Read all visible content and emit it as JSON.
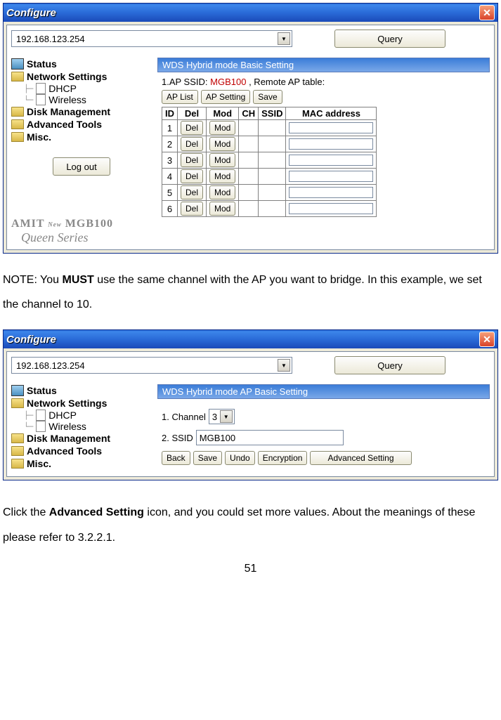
{
  "window_title": "Configure",
  "address": "192.168.123.254",
  "query_btn": "Query",
  "sidebar": {
    "status": "Status",
    "network": "Network Settings",
    "dhcp": "DHCP",
    "wireless": "Wireless",
    "disk": "Disk Management",
    "advanced": "Advanced Tools",
    "misc": "Misc.",
    "logout": "Log out",
    "brand_prefix": "AMIT",
    "brand_new": "New",
    "brand_model": "MGB100",
    "brand_series": "Queen Series"
  },
  "screen1": {
    "panel_title": "WDS Hybrid mode Basic Setting",
    "line_ssid_label": "1.AP SSID:",
    "line_ssid_value": "MGB100",
    "line_remote": ", Remote AP table:",
    "btn_aplist": "AP List",
    "btn_apsetting": "AP Setting",
    "btn_save": "Save",
    "hdr_id": "ID",
    "hdr_del": "Del",
    "hdr_mod": "Mod",
    "hdr_ch": "CH",
    "hdr_ssid": "SSID",
    "hdr_mac": "MAC address",
    "rowcell_del": "Del",
    "rowcell_mod": "Mod",
    "row_ids": [
      "1",
      "2",
      "3",
      "4",
      "5",
      "6"
    ]
  },
  "note_text_pre": "NOTE: You ",
  "note_must": "MUST",
  "note_text_post": " use the same channel with the AP you want to bridge. In this example, we set the channel to 10.",
  "screen2": {
    "panel_title": "WDS Hybrid mode AP Basic Setting",
    "lbl_channel": "1. Channel",
    "channel_value": "3",
    "lbl_ssid": "2. SSID",
    "ssid_value": "MGB100",
    "btn_back": "Back",
    "btn_save": "Save",
    "btn_undo": "Undo",
    "btn_encryption": "Encryption",
    "btn_advanced": "Advanced Setting"
  },
  "bottom_text_pre": "Click the ",
  "bottom_bold": "Advanced Setting",
  "bottom_text_post": " icon, and you could set more values. About the meanings of these please refer to 3.2.2.1.",
  "page_number": "51"
}
